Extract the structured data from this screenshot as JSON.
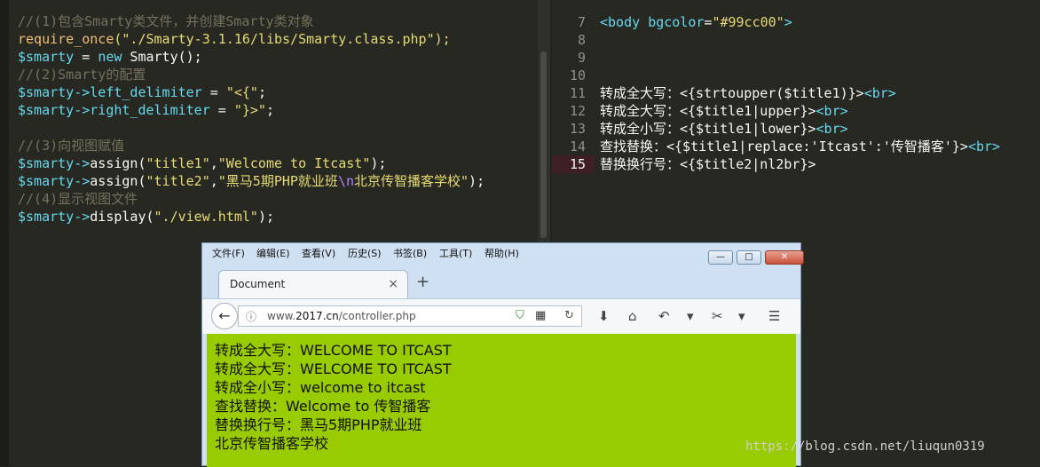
{
  "left_editor": {
    "lines": [
      {
        "parts": [
          {
            "t": "//(1)包含Smarty类文件，并创建Smarty类对象",
            "c": "c-comment"
          }
        ]
      },
      {
        "parts": [
          {
            "t": "require_once",
            "c": "c-func"
          },
          {
            "t": "(\"./Smarty-3.1.16/libs/Smarty.class.php\");",
            "c": "c-str"
          }
        ]
      },
      {
        "parts": [
          {
            "t": "$smarty",
            "c": "c-var"
          },
          {
            "t": " = ",
            "c": "c-plain"
          },
          {
            "t": "new",
            "c": "c-kw"
          },
          {
            "t": " Smarty();",
            "c": "c-plain"
          }
        ]
      },
      {
        "parts": [
          {
            "t": "//(2)Smarty的配置",
            "c": "c-comment"
          }
        ]
      },
      {
        "parts": [
          {
            "t": "$smarty->left_delimiter",
            "c": "c-var"
          },
          {
            "t": " = ",
            "c": "c-plain"
          },
          {
            "t": "\"<{\"",
            "c": "c-str"
          },
          {
            "t": ";",
            "c": "c-plain"
          }
        ]
      },
      {
        "parts": [
          {
            "t": "$smarty->right_delimiter",
            "c": "c-var"
          },
          {
            "t": " = ",
            "c": "c-plain"
          },
          {
            "t": "\"}>\"",
            "c": "c-str"
          },
          {
            "t": ";",
            "c": "c-plain"
          }
        ]
      },
      {
        "parts": []
      },
      {
        "parts": [
          {
            "t": "//(3)向视图赋值",
            "c": "c-comment"
          }
        ]
      },
      {
        "parts": [
          {
            "t": "$smarty->",
            "c": "c-var"
          },
          {
            "t": "assign(",
            "c": "c-plain"
          },
          {
            "t": "\"title1\"",
            "c": "c-str"
          },
          {
            "t": ",",
            "c": "c-plain"
          },
          {
            "t": "\"Welcome to Itcast\"",
            "c": "c-str"
          },
          {
            "t": ");",
            "c": "c-plain"
          }
        ]
      },
      {
        "parts": [
          {
            "t": "$smarty->",
            "c": "c-var"
          },
          {
            "t": "assign(",
            "c": "c-plain"
          },
          {
            "t": "\"title2\"",
            "c": "c-str"
          },
          {
            "t": ",",
            "c": "c-plain"
          },
          {
            "t": "\"黑马5期PHP就业班",
            "c": "c-str"
          },
          {
            "t": "\\n",
            "c": "c-esc"
          },
          {
            "t": "北京传智播客学校\"",
            "c": "c-str"
          },
          {
            "t": ");",
            "c": "c-plain"
          }
        ]
      },
      {
        "parts": [
          {
            "t": "//(4)显示视图文件",
            "c": "c-comment"
          }
        ]
      },
      {
        "parts": [
          {
            "t": "$smarty->",
            "c": "c-var"
          },
          {
            "t": "display(",
            "c": "c-plain"
          },
          {
            "t": "\"./view.html\"",
            "c": "c-str"
          },
          {
            "t": ");",
            "c": "c-plain"
          }
        ]
      }
    ]
  },
  "right_editor": {
    "line_numbers": [
      "7",
      "8",
      "9",
      "10",
      "11",
      "12",
      "13",
      "14",
      "15"
    ],
    "active_line": "15",
    "lines": [
      {
        "parts": [
          {
            "t": "<body ",
            "c": "c-var"
          },
          {
            "t": "bgcolor",
            "c": "c-var"
          },
          {
            "t": "=",
            "c": "c-plain"
          },
          {
            "t": "\"#99cc00\"",
            "c": "c-str"
          },
          {
            "t": ">",
            "c": "c-var"
          }
        ]
      },
      {
        "parts": []
      },
      {
        "parts": []
      },
      {
        "parts": []
      },
      {
        "parts": [
          {
            "t": "转成全大写：<{strtoupper($title1)}>",
            "c": "c-plain"
          },
          {
            "t": "<br>",
            "c": "c-var"
          }
        ]
      },
      {
        "parts": [
          {
            "t": "转成全大写：<{$title1|upper}>",
            "c": "c-plain"
          },
          {
            "t": "<br>",
            "c": "c-var"
          }
        ]
      },
      {
        "parts": [
          {
            "t": "转成全小写：<{$title1|lower}>",
            "c": "c-plain"
          },
          {
            "t": "<br>",
            "c": "c-var"
          }
        ]
      },
      {
        "parts": [
          {
            "t": "查找替换：<{$title1|replace:'Itcast':'传智播客'}>",
            "c": "c-plain"
          },
          {
            "t": "<br>",
            "c": "c-var"
          }
        ]
      },
      {
        "parts": [
          {
            "t": "替换换行号：<{$title2|nl2br}>",
            "c": "c-plain"
          }
        ]
      }
    ]
  },
  "browser": {
    "menu": [
      "文件(F)",
      "编辑(E)",
      "查看(V)",
      "历史(S)",
      "书签(B)",
      "工具(T)",
      "帮助(H)"
    ],
    "window_buttons": {
      "minimize": "—",
      "maximize": "□",
      "close": "✕"
    },
    "tab_title": "Document",
    "tab_close": "×",
    "new_tab": "+",
    "url_prefix": "www.",
    "url_domain": "2017.cn",
    "url_path": "/controller.php",
    "icons": {
      "back": "←",
      "info": "ⓘ",
      "shield": "⛉",
      "qr": "▦",
      "reload": "↻",
      "download": "⬇",
      "home": "⌂",
      "undo": "↶",
      "dropdown": "▾",
      "extension": "✂",
      "menu": "☰"
    },
    "content_bg": "#99cc00",
    "output_lines": [
      "转成全大写：WELCOME TO ITCAST",
      "转成全大写：WELCOME TO ITCAST",
      "转成全小写：welcome to itcast",
      "查找替换：Welcome to 传智播客",
      "替换换行号：黑马5期PHP就业班",
      "北京传智播客学校"
    ]
  },
  "watermark": "https://blog.csdn.net/liuqun0319"
}
